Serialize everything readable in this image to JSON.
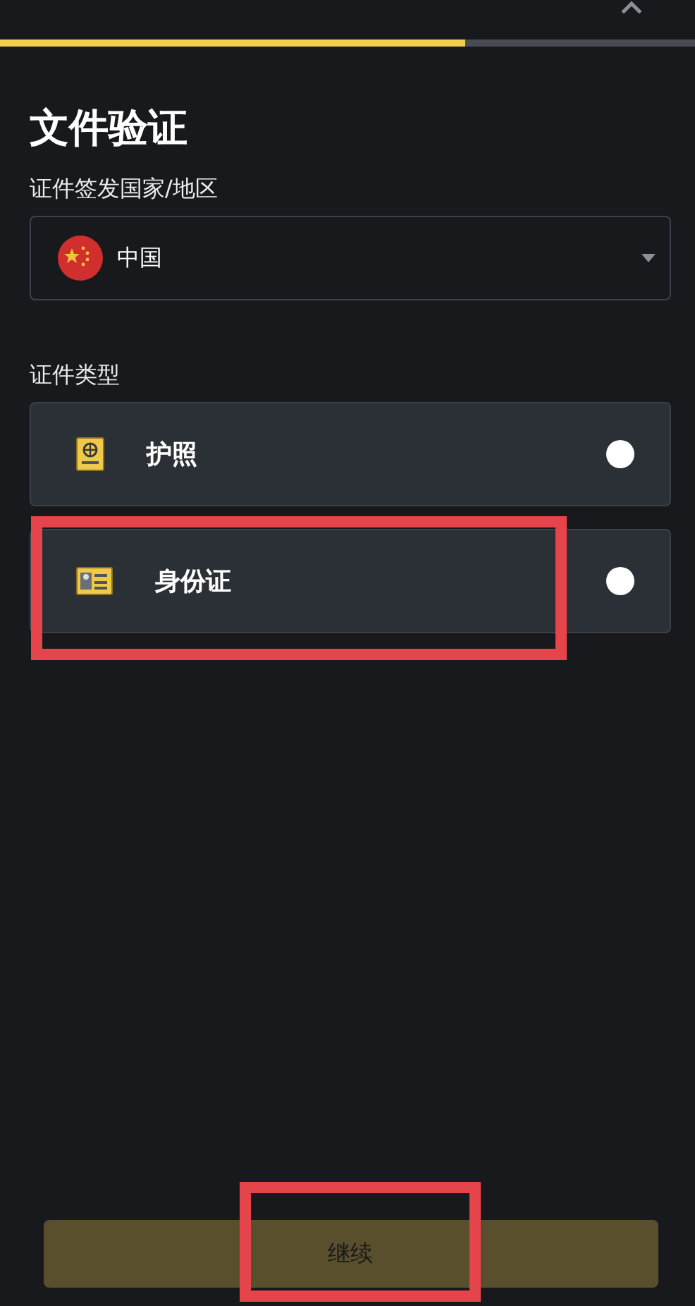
{
  "progress": {
    "level": 0.67
  },
  "title": "文件验证",
  "country": {
    "label": "证件签发国家/地区",
    "value": "中国"
  },
  "doc_type": {
    "label": "证件类型",
    "options": [
      {
        "kind": "passport",
        "label": "护照",
        "selected": false,
        "highlighted": false
      },
      {
        "kind": "id_card",
        "label": "身份证",
        "selected": false,
        "highlighted": true
      }
    ]
  },
  "continue_button": {
    "label": "继续",
    "disabled": true,
    "highlighted": true
  }
}
